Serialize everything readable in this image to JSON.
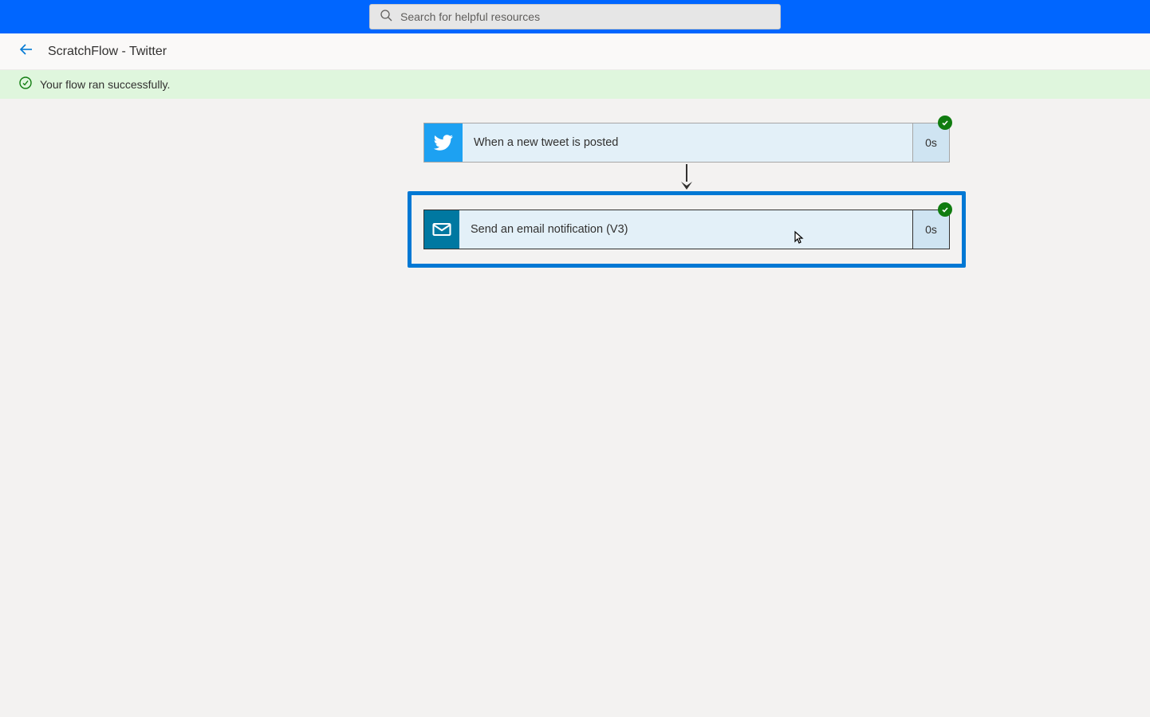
{
  "search": {
    "placeholder": "Search for helpful resources"
  },
  "breadcrumb": {
    "title": "ScratchFlow - Twitter"
  },
  "status": {
    "message": "Your flow ran successfully."
  },
  "steps": {
    "trigger": {
      "label": "When a new tweet is posted",
      "duration": "0s",
      "icon": "twitter-icon"
    },
    "action": {
      "label": "Send an email notification (V3)",
      "duration": "0s",
      "icon": "mail-icon"
    }
  }
}
